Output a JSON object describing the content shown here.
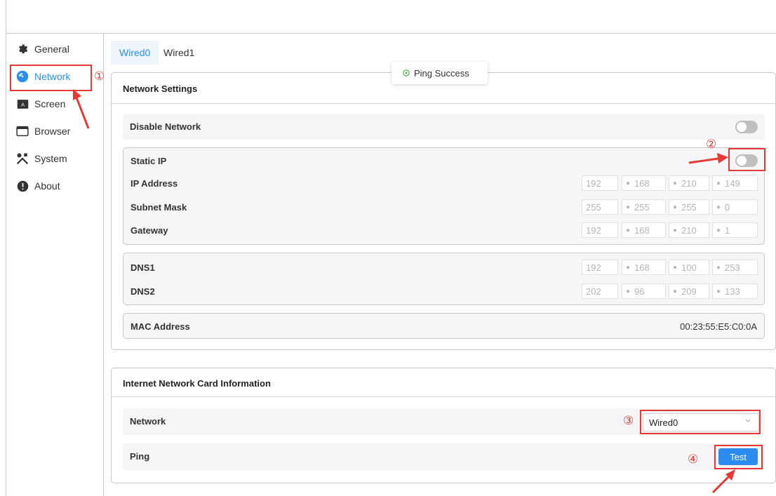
{
  "sidebar": {
    "items": [
      {
        "label": "General",
        "icon": "gear-icon"
      },
      {
        "label": "Network",
        "icon": "network-icon",
        "active": true
      },
      {
        "label": "Screen",
        "icon": "screen-icon"
      },
      {
        "label": "Browser",
        "icon": "browser-icon"
      },
      {
        "label": "System",
        "icon": "tools-icon"
      },
      {
        "label": "About",
        "icon": "info-icon"
      }
    ]
  },
  "tabs": [
    {
      "label": "Wired0",
      "active": true
    },
    {
      "label": "Wired1",
      "active": false
    }
  ],
  "toast": {
    "text": "Ping Success",
    "icon": "check-circle-icon"
  },
  "network_settings": {
    "title": "Network Settings",
    "disable_network": {
      "label": "Disable Network",
      "on": false
    },
    "static_ip": {
      "label": "Static IP",
      "on": false
    },
    "ip_address": {
      "label": "IP Address",
      "octets": [
        "192",
        "168",
        "210",
        "149"
      ]
    },
    "subnet_mask": {
      "label": "Subnet Mask",
      "octets": [
        "255",
        "255",
        "255",
        "0"
      ]
    },
    "gateway": {
      "label": "Gateway",
      "octets": [
        "192",
        "168",
        "210",
        "1"
      ]
    },
    "dns1": {
      "label": "DNS1",
      "octets": [
        "192",
        "168",
        "100",
        "253"
      ]
    },
    "dns2": {
      "label": "DNS2",
      "octets": [
        "202",
        "96",
        "209",
        "133"
      ]
    },
    "mac": {
      "label": "MAC Address",
      "value": "00:23:55:E5:C0:0A"
    }
  },
  "card_info": {
    "title": "Internet Network Card Information",
    "network": {
      "label": "Network",
      "selected": "Wired0"
    },
    "ping": {
      "label": "Ping",
      "button": "Test"
    }
  },
  "annotations": [
    "①",
    "②",
    "③",
    "④"
  ],
  "colors": {
    "accent": "#2b8ff0",
    "annotation": "#e53935",
    "success": "#4caf50"
  }
}
